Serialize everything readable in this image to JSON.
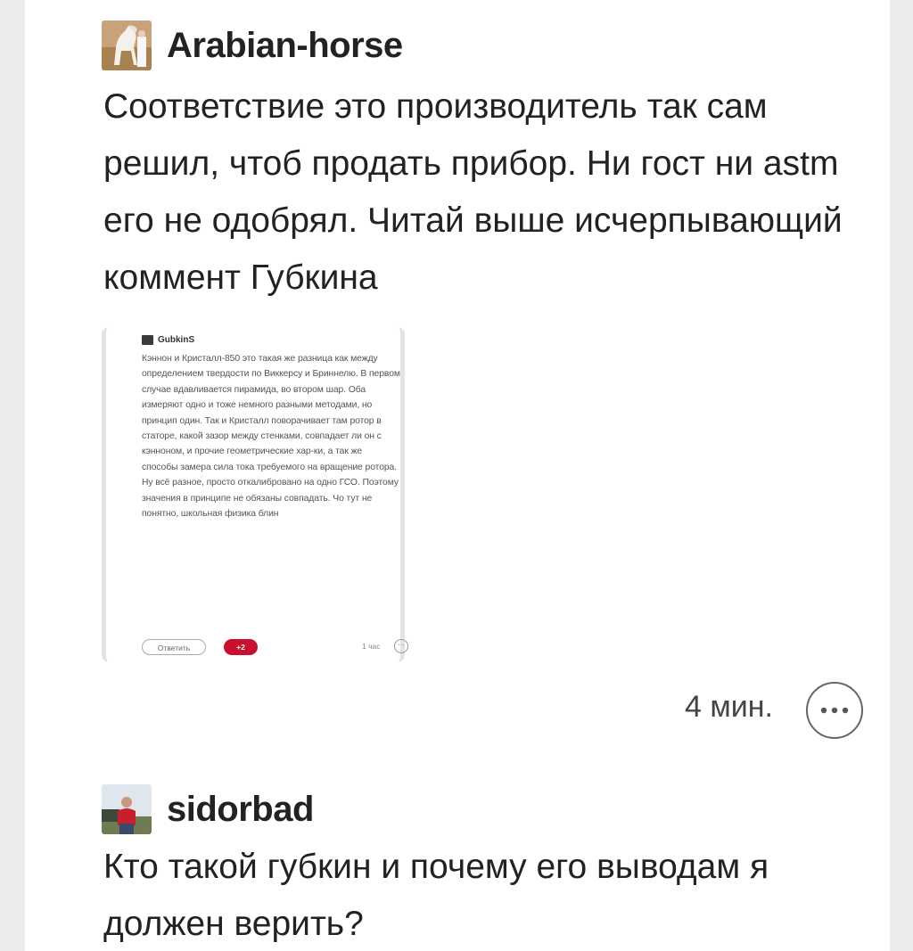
{
  "comments": [
    {
      "username": "Arabian-horse",
      "avatar_icon": "horse-photo-avatar",
      "text": "Соответствие это производитель так сам решил, чтоб продать прибор. Ни гост ни astm его не одобрял. Читай выше исчерпывающий коммент Губкина",
      "time": "4 мин.",
      "more_icon": "more-dots-icon",
      "embedded_screenshot": {
        "username": "GubkinS",
        "text": "Кэннон и Кристалл-850 это такая же разница как между определением твердости по Виккерсу и Бриннелю. В первом случае вдавливается пирамида, во втором шар. Оба измеряют одно и тоже немного разными методами, но принцип один. Так и Кристалл поворачивает там ротор в статоре, какой зазор между стенками, совпадает ли он с кэнноном, и прочие геометрические хар-ки, а так же способы замера сила тока требуемого на вращение ротора. Ну всё разное, просто откалибровано на одно ГСО. Поэтому значения в принципе не обязаны совпадать. Чо тут не понятно, школьная физика блин",
        "reply_label": "Ответить",
        "rating": "+2",
        "time": "1 час"
      }
    },
    {
      "username": "sidorbad",
      "avatar_icon": "man-photo-avatar",
      "text": "Кто такой губкин и почему его выводам я должен верить?"
    }
  ],
  "colors": {
    "rating_badge": "#c8102e",
    "background": "#ececec",
    "card": "#ffffff"
  }
}
